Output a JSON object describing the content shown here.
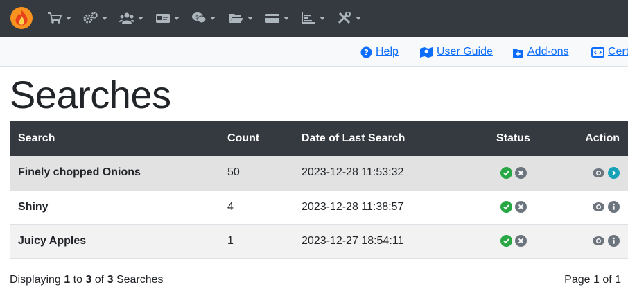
{
  "nav": {
    "items": [
      {
        "icon": "cart-icon"
      },
      {
        "icon": "gears-icon"
      },
      {
        "icon": "users-icon"
      },
      {
        "icon": "id-card-icon"
      },
      {
        "icon": "comments-dollar-icon"
      },
      {
        "icon": "folder-open-icon"
      },
      {
        "icon": "credit-card-icon"
      },
      {
        "icon": "chart-bar-icon"
      },
      {
        "icon": "tools-icon"
      }
    ]
  },
  "links": {
    "help": "Help",
    "user_guide": "User Guide",
    "addons": "Add-ons",
    "cert": "Cert"
  },
  "page": {
    "title": "Searches"
  },
  "table": {
    "headers": {
      "search": "Search",
      "count": "Count",
      "date": "Date of Last Search",
      "status": "Status",
      "action": "Action"
    },
    "rows": [
      {
        "search": "Finely chopped Onions",
        "count": "50",
        "date": "2023-12-28 11:53:32",
        "action2": "chevron-right-icon"
      },
      {
        "search": "Shiny",
        "count": "4",
        "date": "2023-12-28 11:38:57",
        "action2": "info-icon"
      },
      {
        "search": "Juicy Apples",
        "count": "1",
        "date": "2023-12-27 18:54:11",
        "action2": "info-icon"
      }
    ]
  },
  "footer": {
    "displaying": "Displaying",
    "from": "1",
    "to_word": "to",
    "to": "3",
    "of_word": "of",
    "total": "3",
    "noun": "Searches",
    "page_info": "Page 1 of 1"
  },
  "colors": {
    "navbar": "#343a40",
    "link": "#0d6efd",
    "success": "#28a745",
    "muted": "#6c757d",
    "info": "#17a2b8"
  }
}
